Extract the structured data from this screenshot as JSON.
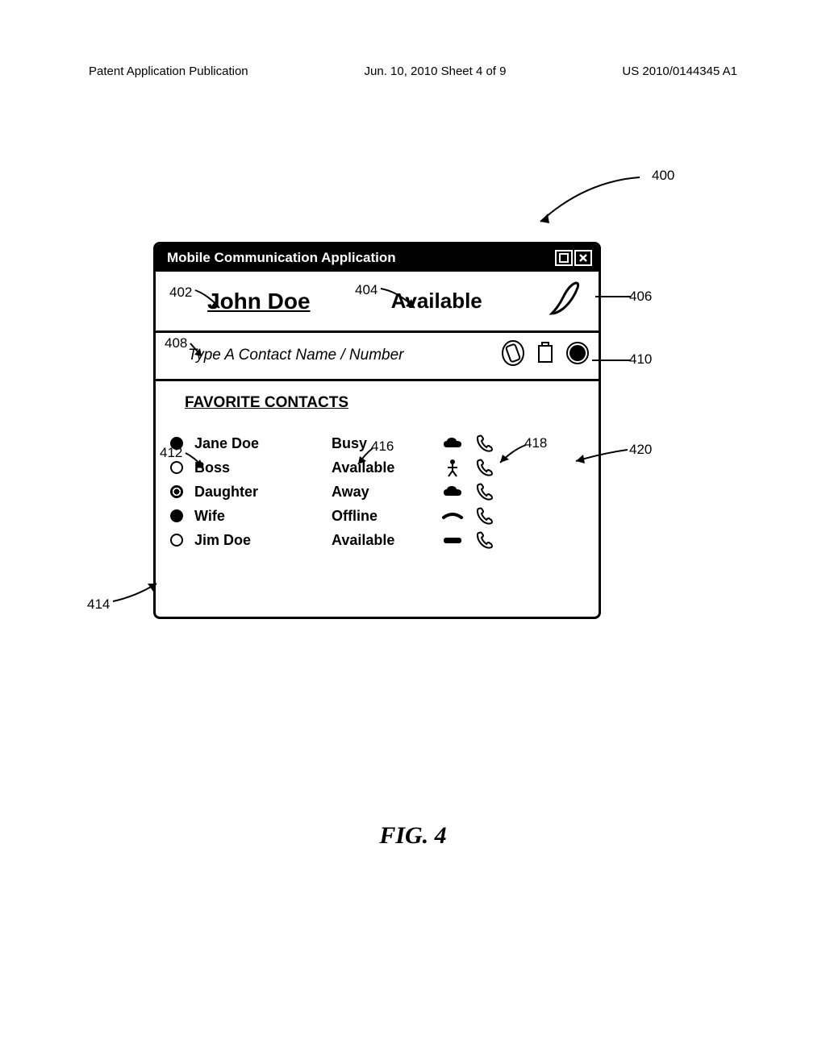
{
  "page_header": {
    "left": "Patent Application Publication",
    "center": "Jun. 10, 2010  Sheet 4 of 9",
    "right": "US 2010/0144345 A1"
  },
  "window": {
    "title": "Mobile Communication Application"
  },
  "user": {
    "name": "John Doe",
    "status": "Available"
  },
  "search": {
    "placeholder": "Type A Contact Name / Number"
  },
  "contacts_heading": "FAVORITE CONTACTS",
  "contacts": [
    {
      "name": "Jane Doe",
      "status": "Busy",
      "presence": "filled",
      "type_icon": "cloud",
      "phone": true
    },
    {
      "name": "Boss",
      "status": "Available",
      "presence": "open",
      "type_icon": "person",
      "phone": true
    },
    {
      "name": "Daughter",
      "status": "Away",
      "presence": "half",
      "type_icon": "cloud",
      "phone": true
    },
    {
      "name": "Wife",
      "status": "Offline",
      "presence": "filled",
      "type_icon": "dash",
      "phone": true
    },
    {
      "name": "Jim Doe",
      "status": "Available",
      "presence": "open",
      "type_icon": "bar",
      "phone": true
    }
  ],
  "callouts": {
    "c400": "400",
    "c402": "402",
    "c404": "404",
    "c406": "406",
    "c408": "408",
    "c410": "410",
    "c412": "412",
    "c414": "414",
    "c416": "416",
    "c418": "418",
    "c420": "420"
  },
  "figure_caption": "FIG. 4"
}
